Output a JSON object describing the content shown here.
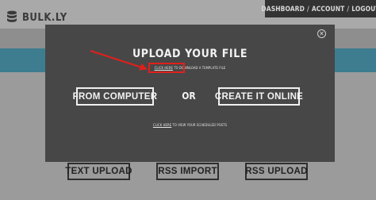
{
  "app": {
    "logo_text": "BULK.LY",
    "logo_icon": "database-icon"
  },
  "topnav": {
    "dashboard": "DASHBOARD",
    "account": "ACCOUNT",
    "logout": "LOGOUT",
    "separator": "/"
  },
  "background_buttons": {
    "text_upload": "TEXT UPLOAD",
    "rss_import": "RSS IMPORT",
    "rss_upload": "RSS UPLOAD"
  },
  "modal": {
    "close_icon": "close-icon",
    "title": "UPLOAD YOUR FILE",
    "template_link": "CLICK HERE",
    "template_rest": " TO DOWNLOAD A TEMPLATE FILE",
    "from_computer": "FROM COMPUTER",
    "or": "OR",
    "create_online": "CREATE IT ONLINE",
    "scheduled_link": "CLICK HERE",
    "scheduled_rest": " TO VIEW YOUR SCHEDULED POSTS"
  },
  "annotation": {
    "highlight_color": "#e0201c",
    "arrow_icon": "red-arrow-icon"
  }
}
